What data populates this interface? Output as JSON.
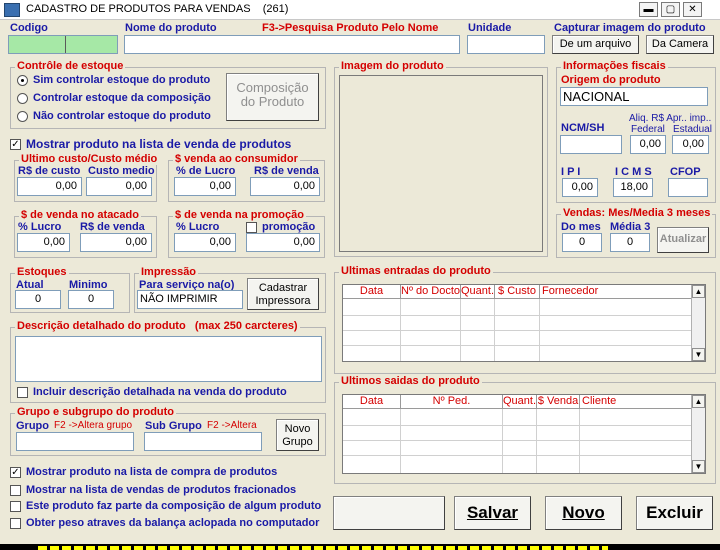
{
  "window": {
    "title": "CADASTRO DE PRODUTOS PARA VENDAS",
    "count": "(261)"
  },
  "top": {
    "codigo_label": "Codigo",
    "nome_label": "Nome do produto",
    "f3_hint": "F3->Pesquisa Produto Pelo Nome",
    "unidade_label": "Unidade",
    "capturar_label": "Capturar imagem do produto",
    "de_um_arquivo": "De um arquivo",
    "da_camera": "Da Camera"
  },
  "estoque_ctrl": {
    "title": "Contrôle de estoque",
    "options": [
      "Sim controlar estoque do produto",
      "Controlar estoque da composição",
      "Não controlar estoque do produto"
    ],
    "composicao_btn": "Composição do Produto"
  },
  "mostrar_lista": "Mostrar produto na lista de venda de produtos",
  "custo": {
    "title": "Ultimo custo/Custo médio",
    "col1": "R$ de custo",
    "col2": "Custo medio",
    "v1": "0,00",
    "v2": "0,00"
  },
  "venda_consumidor": {
    "title": "$ venda ao consumidor",
    "col1": "% de Lucro",
    "col2": "R$ de venda",
    "v1": "0,00",
    "v2": "0,00"
  },
  "venda_atacado": {
    "title": "$ de venda no atacado",
    "col1": "% Lucro",
    "col2": "R$ de venda",
    "v1": "0,00",
    "v2": "0,00"
  },
  "venda_promocao": {
    "title": "$ de venda na promoção",
    "col1": "% Lucro",
    "col2": "promoção",
    "v1": "0,00",
    "v2": "0,00"
  },
  "estoques": {
    "title": "Estoques",
    "atual": "Atual",
    "minimo": "Minimo",
    "v1": "0",
    "v2": "0"
  },
  "impressao": {
    "title": "Impressão",
    "label": "Para serviço na(o)",
    "value": "NÃO IMPRIMIR",
    "btn": "Cadastrar Impressora"
  },
  "descricao": {
    "title": "Descrição detalhado do produto",
    "max": "(max 250 carcteres)",
    "incluir": "Incluir descrição detalhada na venda do produto"
  },
  "grupo": {
    "title": "Grupo e subgrupo do produto",
    "grupo": "Grupo",
    "grupo_hint": "F2 ->Altera grupo",
    "sub": "Sub Grupo",
    "sub_hint": "F2 ->Altera",
    "btn": "Novo Grupo"
  },
  "bottom_checks": [
    "Mostrar produto na lista de compra de produtos",
    "Mostrar na lista  de  vendas de produtos fracionados",
    "Este produto faz parte da composição de algum produto",
    "Obter peso atraves da balança aclopada no computador"
  ],
  "imagem": {
    "title": "Imagem do produto"
  },
  "fiscais": {
    "title": "Informações fiscais",
    "origem_label": "Origem do produto",
    "origem_value": "NACIONAL",
    "ncm": "NCM/SH",
    "aliq_label": "Aliq. R$ Apr.. imp..",
    "federal": "Federal",
    "estadual": "Estadual",
    "federal_v": "0,00",
    "estadual_v": "0,00",
    "ipi": "I P I",
    "icms": "I C M S",
    "cfop": "CFOP",
    "ipi_v": "0,00",
    "icms_v": "18,00"
  },
  "vendas_mes": {
    "title": "Vendas: Mes/Media 3 meses",
    "do_mes": "Do mes",
    "media3": "Média 3",
    "v1": "0",
    "v2": "0",
    "btn": "Atualizar"
  },
  "entradas": {
    "title": "Ultimas entradas do produto",
    "cols": [
      "Data",
      "Nº do Docto",
      "Quant.",
      "$ Custo",
      "Fornecedor"
    ]
  },
  "saidas": {
    "title": "Ultimos saidas do produto",
    "cols": [
      "Data",
      "Nº Ped.",
      "Quant.",
      "$ Venda",
      "Cliente"
    ]
  },
  "actions": {
    "salvar": "Salvar",
    "novo": "Novo",
    "excluir": "Excluir"
  },
  "colors": {
    "label_blue": "#1a1aa6",
    "label_red": "#d40000",
    "bg": "#ece9d8",
    "codigo_green": "#a6e8a6",
    "status_yellow": "#ffff00"
  }
}
